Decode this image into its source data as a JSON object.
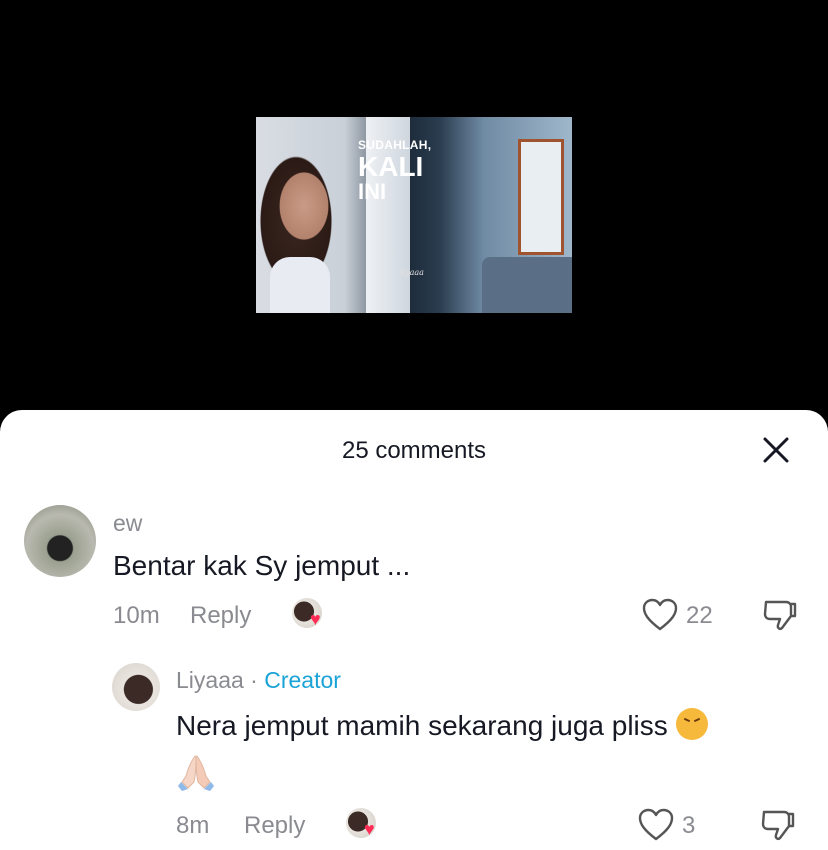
{
  "video": {
    "overlay_line1": "SUDAHLAH,",
    "overlay_line2": "KALI",
    "overlay_line3": "INI",
    "watermark": "liyaaa"
  },
  "comments_sheet": {
    "title": "25 comments"
  },
  "comments": [
    {
      "username": "ew",
      "text": "Bentar kak Sy jemput ...",
      "time": "10m",
      "reply_label": "Reply",
      "like_count": "22"
    },
    {
      "username": "Liyaaa",
      "separator": " · ",
      "badge": "Creator",
      "text_line1": "Nera jemput mamih sekarang juga pliss",
      "time": "8m",
      "reply_label": "Reply",
      "like_count": "3"
    }
  ],
  "icons": {
    "close": "close-icon",
    "heart": "heart-icon",
    "dislike": "thumbs-down-icon",
    "emoji_confounded": "confounded-face-emoji",
    "emoji_pray": "folded-hands-emoji"
  },
  "colors": {
    "accent_creator": "#1aa3d6",
    "like_heart": "#fe2c55"
  }
}
